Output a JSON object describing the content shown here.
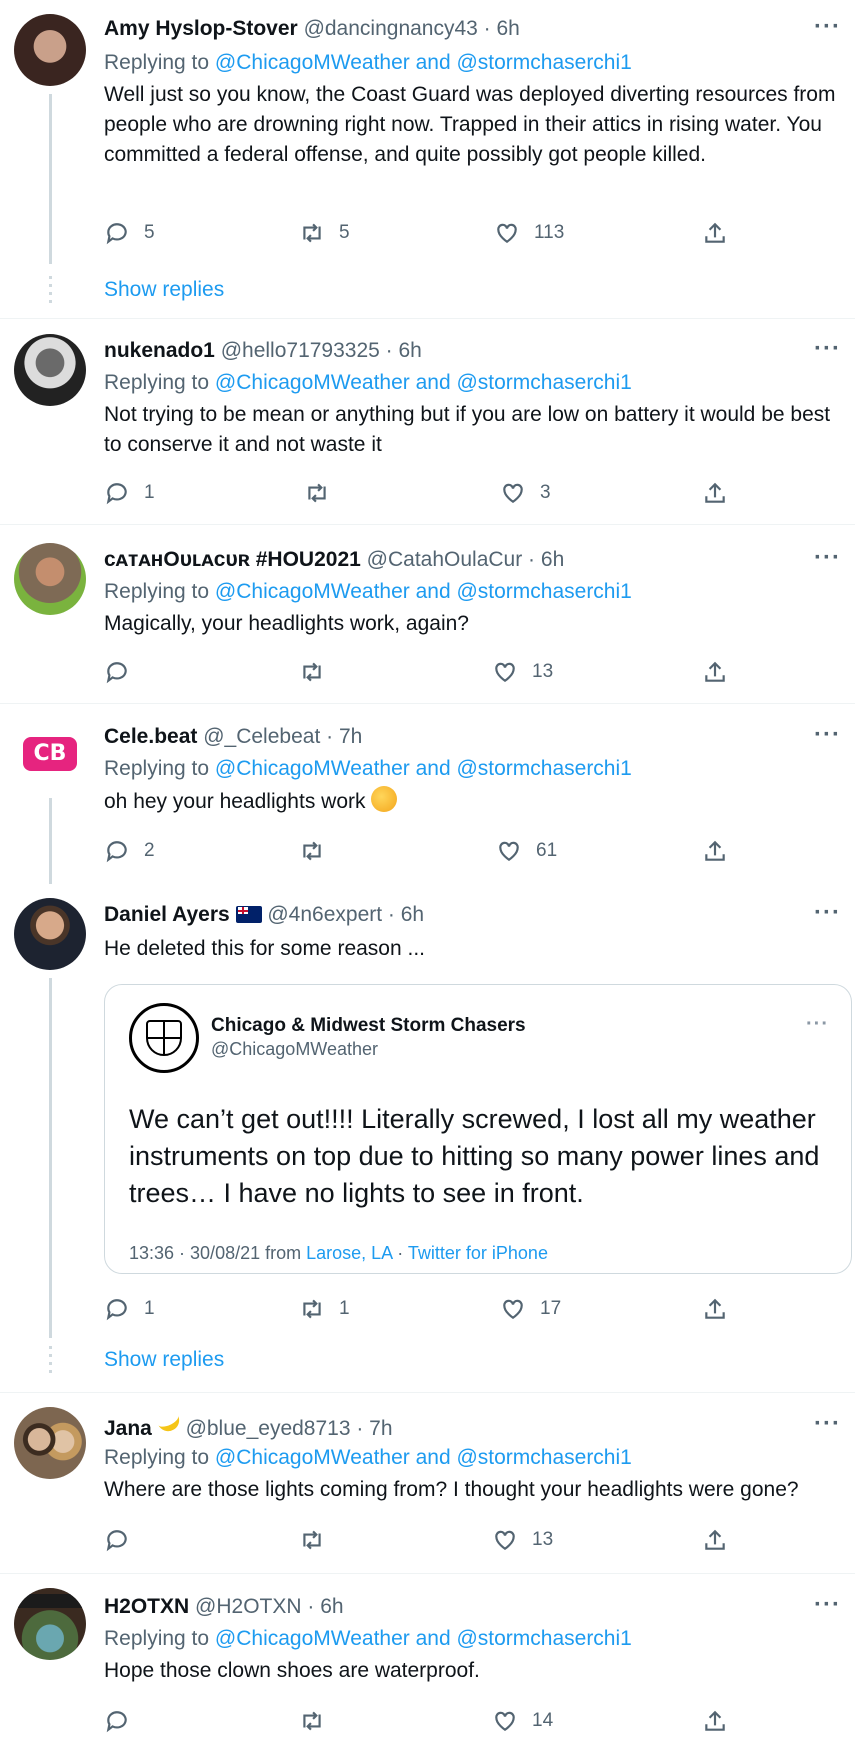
{
  "reply_prefix": "Replying to",
  "show_replies_label": "Show replies",
  "more_label": "···",
  "colors": {
    "accent": "#1d9bf0",
    "muted": "#536471",
    "divider": "#eff3f4",
    "thread": "#cfd9de"
  },
  "tweets": [
    {
      "name": "Amy Hyslop-Stover",
      "handle": "@dancingnancy43 · 6h",
      "mentions": "@ChicagoMWeather and @stormchaserchi1",
      "text": "Well just so you know, the Coast Guard was deployed diverting resources from people who are drowning right now. Trapped in their attics in rising water. You committed a federal offense, and quite possibly got people killed.",
      "replies": "5",
      "retweets": "5",
      "likes": "113"
    },
    {
      "name": "nukenado1",
      "handle": "@hello71793325 · 6h",
      "mentions": "@ChicagoMWeather and @stormchaserchi1",
      "text": "Not trying to be mean or anything but if you are low on battery it would be best to conserve it and not waste it",
      "replies": "1",
      "retweets": "",
      "likes": "3"
    },
    {
      "name": "ᴄᴀᴛᴀʜOᴜʟᴀᴄᴜʀ #HOU2021",
      "handle": "@CatahOulaCur · 6h",
      "mentions": "@ChicagoMWeather and @stormchaserchi1",
      "text": "Magically, your headlights work, again?",
      "replies": "",
      "retweets": "",
      "likes": "13"
    },
    {
      "name": "Cele.beat",
      "handle": "@_Celebeat · 7h",
      "mentions": "@ChicagoMWeather and @stormchaserchi1",
      "text": "oh hey your headlights work",
      "emoji": "thinking-face",
      "replies": "2",
      "retweets": "",
      "likes": "61"
    },
    {
      "name": "Daniel Ayers",
      "handle": "@4n6expert · 6h",
      "flag": "australia-flag",
      "text": "He deleted this for some reason ...",
      "quote": {
        "name": "Chicago & Midwest Storm Chasers",
        "handle": "@ChicagoMWeather",
        "text": "We can’t get out!!!! Literally screwed, I lost all my weather instruments on top due to hitting so many power lines and trees… I have no lights to see in front.",
        "time": "13:36 · 30/08/21 from",
        "location": "Larose, LA",
        "separator": "·",
        "client": "Twitter for iPhone"
      },
      "replies": "1",
      "retweets": "1",
      "likes": "17"
    },
    {
      "name": "Jana",
      "handle": "@blue_eyed8713 · 7h",
      "name_emoji": "banana",
      "mentions": "@ChicagoMWeather and @stormchaserchi1",
      "text": "Where are those lights coming from? I thought your headlights were gone?",
      "replies": "",
      "retweets": "",
      "likes": "13"
    },
    {
      "name": "H2OTXN",
      "handle": "@H2OTXN · 6h",
      "mentions": "@ChicagoMWeather and @stormchaserchi1",
      "text": "Hope those clown shoes are waterproof.",
      "replies": "",
      "retweets": "",
      "likes": "14"
    }
  ]
}
